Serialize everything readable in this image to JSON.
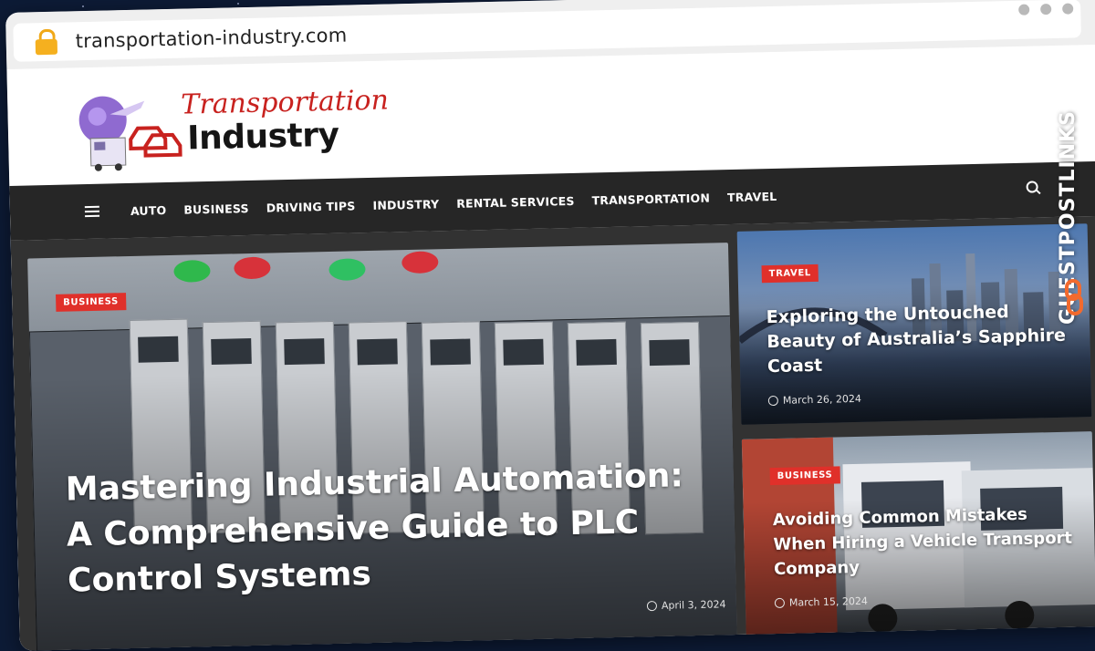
{
  "browser": {
    "url": "transportation-industry.com"
  },
  "logo": {
    "line1": "Transportation",
    "line2": "Industry"
  },
  "nav": {
    "items": [
      "AUTO",
      "BUSINESS",
      "DRIVING TIPS",
      "INDUSTRY",
      "RENTAL SERVICES",
      "TRANSPORTATION",
      "TRAVEL"
    ]
  },
  "featured": {
    "category": "BUSINESS",
    "title": "Mastering Industrial Automation: A Comprehensive Guide to PLC Control Systems",
    "date": "April 3, 2024"
  },
  "side_posts": [
    {
      "category": "TRAVEL",
      "title": "Exploring the Untouched Beauty of Australia’s Sapphire Coast",
      "date": "March 26, 2024"
    },
    {
      "category": "BUSINESS",
      "title": "Avoiding Common Mistakes When Hiring a Vehicle Transport Company",
      "date": "March 15, 2024"
    }
  ],
  "watermark": {
    "text": "GUESTPOSTLINKS"
  },
  "colors": {
    "navbar": "#262626",
    "accent_red": "#e0302a",
    "lock": "#f5b01f"
  }
}
